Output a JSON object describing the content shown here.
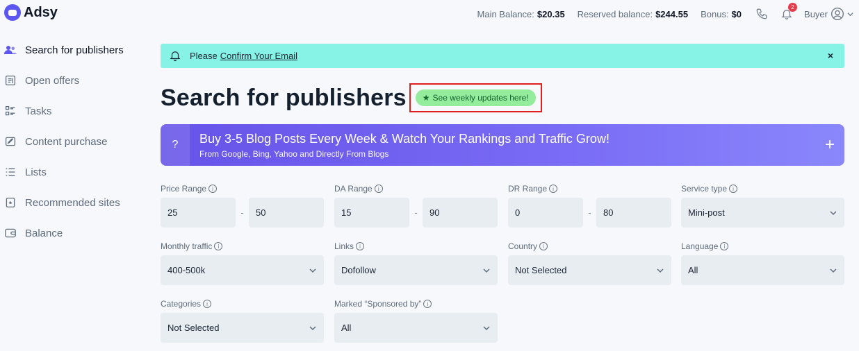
{
  "header": {
    "logo_text": "Adsy",
    "main_balance_label": "Main Balance:",
    "main_balance_value": "$20.35",
    "reserved_balance_label": "Reserved balance:",
    "reserved_balance_value": "$244.55",
    "bonus_label": "Bonus:",
    "bonus_value": "$0",
    "notifications_count": "2",
    "user_role": "Buyer"
  },
  "sidebar": {
    "items": [
      {
        "label": "Search for publishers",
        "icon": "users-icon"
      },
      {
        "label": "Open offers",
        "icon": "document-icon"
      },
      {
        "label": "Tasks",
        "icon": "tasks-icon"
      },
      {
        "label": "Content purchase",
        "icon": "edit-icon"
      },
      {
        "label": "Lists",
        "icon": "list-icon"
      },
      {
        "label": "Recommended sites",
        "icon": "star-doc-icon"
      },
      {
        "label": "Balance",
        "icon": "wallet-icon"
      }
    ]
  },
  "notice": {
    "text": "Please",
    "link": "Confirm Your Email",
    "close": "×"
  },
  "page": {
    "title": "Search for publishers",
    "updates_label": "See weekly updates here!"
  },
  "promo": {
    "question": "?",
    "headline": "Buy 3-5 Blog Posts Every Week & Watch Your Rankings and Traffic Grow!",
    "subline": "From Google, Bing, Yahoo and Directly From Blogs",
    "plus": "+"
  },
  "filters": {
    "price_range": {
      "label": "Price Range",
      "min": "25",
      "max": "50"
    },
    "da_range": {
      "label": "DA Range",
      "min": "15",
      "max": "90"
    },
    "dr_range": {
      "label": "DR Range",
      "min": "0",
      "max": "80"
    },
    "service_type": {
      "label": "Service type",
      "value": "Mini-post"
    },
    "monthly_traffic": {
      "label": "Monthly traffic",
      "value": "400-500k"
    },
    "links": {
      "label": "Links",
      "value": "Dofollow"
    },
    "country": {
      "label": "Country",
      "value": "Not Selected"
    },
    "language": {
      "label": "Language",
      "value": "All"
    },
    "categories": {
      "label": "Categories",
      "value": "Not Selected"
    },
    "sponsored": {
      "label": "Marked “Sponsored by”",
      "value": "All"
    },
    "range_separator": "-"
  },
  "colors": {
    "accent": "#5b57f0",
    "notice_bg": "#86f3e6",
    "updates_bg": "#94ec9d",
    "highlight_border": "#e01e1e"
  }
}
